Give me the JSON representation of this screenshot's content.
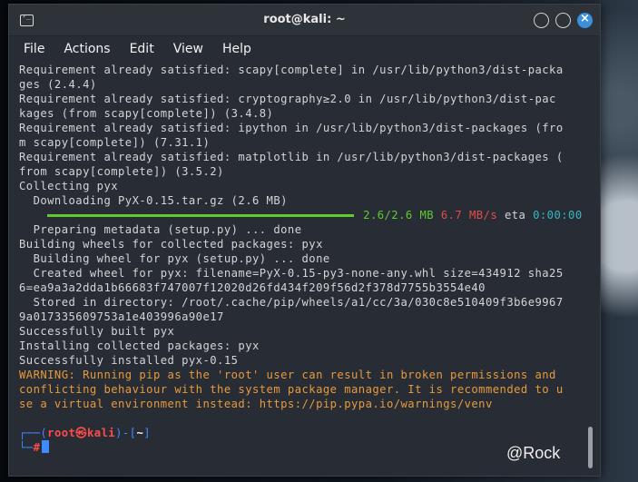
{
  "window": {
    "title": "root@kali: ~",
    "controls": {
      "minimize": "",
      "maximize": "",
      "close": "×"
    }
  },
  "menu": [
    "File",
    "Actions",
    "Edit",
    "View",
    "Help"
  ],
  "terminal": {
    "lines": [
      "Requirement already satisfied: scapy[complete] in /usr/lib/python3/dist-packa",
      "ges (2.4.4)",
      "Requirement already satisfied: cryptography≥2.0 in /usr/lib/python3/dist-pac",
      "kages (from scapy[complete]) (3.4.8)",
      "Requirement already satisfied: ipython in /usr/lib/python3/dist-packages (fro",
      "m scapy[complete]) (7.31.1)",
      "Requirement already satisfied: matplotlib in /usr/lib/python3/dist-packages (",
      "from scapy[complete]) (3.5.2)",
      "Collecting pyx",
      "  Downloading PyX-0.15.tar.gz (2.6 MB)"
    ],
    "progress": {
      "fraction": 1.0,
      "size": "2.6/2.6 MB",
      "speed": "6.7 MB/s",
      "eta_label": "eta",
      "eta": "0:00:00"
    },
    "lines2": [
      "  Preparing metadata (setup.py) ... done",
      "Building wheels for collected packages: pyx",
      "  Building wheel for pyx (setup.py) ... done",
      "  Created wheel for pyx: filename=PyX-0.15-py3-none-any.whl size=434912 sha25",
      "6=ea9a3a2dda1b66683f747007f12020d26fd434f209f56d2f378d7755b3554e40",
      "  Stored in directory: /root/.cache/pip/wheels/a1/cc/3a/030c8e510409f3b6e9967",
      "9a017335609753a1e403996a90e17",
      "Successfully built pyx",
      "Installing collected packages: pyx",
      "Successfully installed pyx-0.15"
    ],
    "warning": [
      "WARNING: Running pip as the 'root' user can result in broken permissions and",
      "conflicting behaviour with the system package manager. It is recommended to u",
      "se a virtual environment instead: https://pip.pypa.io/warnings/venv"
    ],
    "prompt": {
      "line1_start": "┌──(",
      "user": "root㉿kali",
      "line1_mid": ")-[",
      "cwd": "~",
      "line1_end": "]",
      "line2_start": "└─",
      "hash": "#"
    }
  },
  "watermark": "@Rock",
  "colors": {
    "background": "#282c34",
    "progress_bar": "#5fcc2e",
    "warning": "#e69a3d",
    "prompt_blue": "#3d8bff",
    "prompt_red": "#ff4b4b",
    "eta": "#36b6c5",
    "close_button": "#3c8fd9"
  }
}
